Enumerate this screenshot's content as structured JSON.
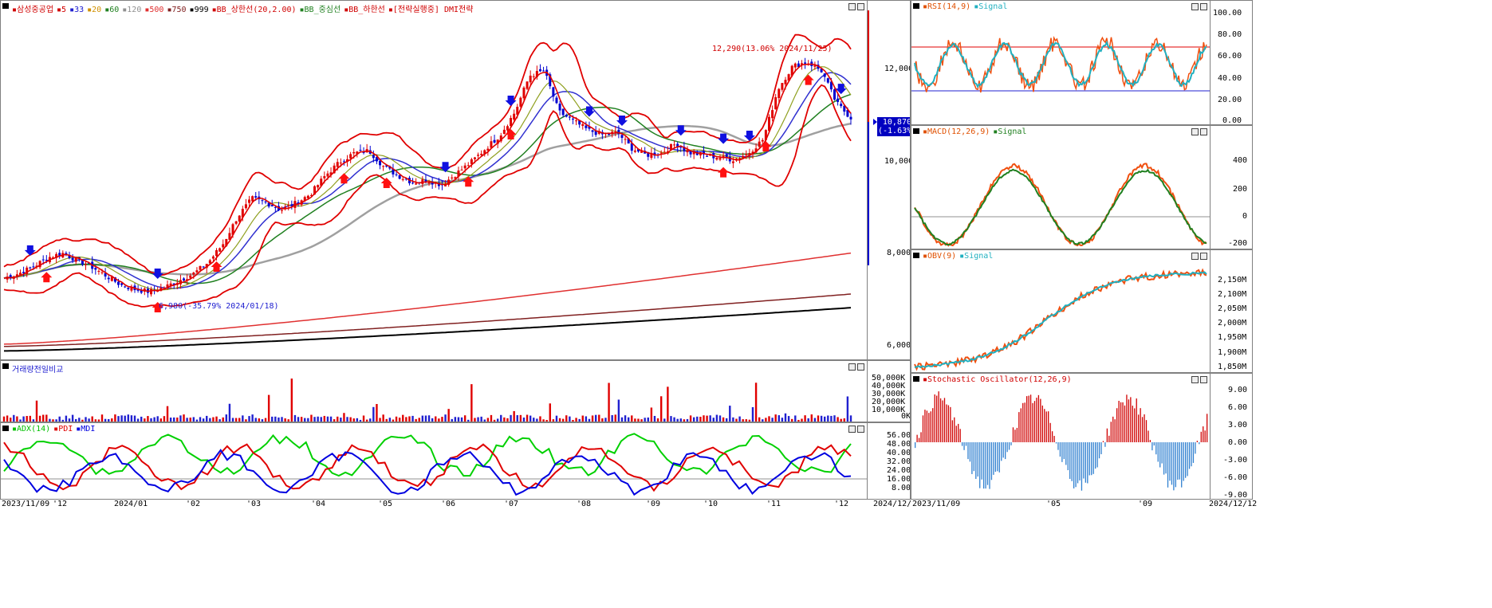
{
  "main_legend": {
    "items": [
      {
        "text": "삼성중공업",
        "color": "#d00000"
      },
      {
        "text": "5",
        "color": "#d00000"
      },
      {
        "text": "33",
        "color": "#2020d0"
      },
      {
        "text": "20",
        "color": "#d09000"
      },
      {
        "text": "60",
        "color": "#208020"
      },
      {
        "text": "120",
        "color": "#909090"
      },
      {
        "text": "500",
        "color": "#e03030"
      },
      {
        "text": "750",
        "color": "#802020"
      },
      {
        "text": "999",
        "color": "#000000"
      },
      {
        "text": "BB_상한선(20,2.00)",
        "color": "#d00000"
      },
      {
        "text": "BB_중심선",
        "color": "#208020"
      },
      {
        "text": "BB_하한선",
        "color": "#d00000"
      },
      {
        "text": "[전략실행중] DMI전략",
        "color": "#d00000"
      }
    ]
  },
  "annotations": {
    "high": "12,290(13.06% 2024/11/25)",
    "low": "6,980(-35.79% 2024/01/18)",
    "current_price": "10,870",
    "current_change": "(-1.63%)"
  },
  "volume_legend": "거래량전일비교",
  "adx_legend": [
    {
      "text": "ADX(14)",
      "color": "#00c000"
    },
    {
      "text": "PDI",
      "color": "#e00000"
    },
    {
      "text": "MDI",
      "color": "#0000e0"
    }
  ],
  "rsi_legend": [
    {
      "text": "RSI(14,9)",
      "color": "#e05000"
    },
    {
      "text": "Signal",
      "color": "#20b0c0"
    }
  ],
  "macd_legend": [
    {
      "text": "MACD(12,26,9)",
      "color": "#e05000"
    },
    {
      "text": "Signal",
      "color": "#208020"
    }
  ],
  "obv_legend": [
    {
      "text": "OBV(9)",
      "color": "#e05000"
    },
    {
      "text": "Signal",
      "color": "#20b0c0"
    }
  ],
  "stoch_legend": [
    {
      "text": "Stochastic Oscillator(12,26,9)",
      "color": "#d00000"
    }
  ],
  "price_axis": [
    "12,000",
    "10,000",
    "8,000",
    "6,000"
  ],
  "volume_axis": [
    "50,000K",
    "40,000K",
    "30,000K",
    "20,000K",
    "10,000K",
    "0K"
  ],
  "adx_axis": [
    "56.00",
    "48.00",
    "40.00",
    "32.00",
    "24.00",
    "16.00",
    "8.00"
  ],
  "rsi_axis": [
    "100.00",
    "80.00",
    "60.00",
    "40.00",
    "20.00",
    "0.00"
  ],
  "macd_axis": [
    "400",
    "200",
    "0",
    "-200"
  ],
  "obv_axis": [
    "2,150M",
    "2,100M",
    "2,050M",
    "2,000M",
    "1,950M",
    "1,900M",
    "1,850M"
  ],
  "stoch_axis": [
    "9.00",
    "6.00",
    "3.00",
    "0.00",
    "-3.00",
    "-6.00",
    "-9.00"
  ],
  "date_axis_main": [
    "2023/11/09",
    "'12",
    "2024/01",
    "'02",
    "'03",
    "'04",
    "'05",
    "'06",
    "'07",
    "'08",
    "'09",
    "'10",
    "'11",
    "'12",
    "2024/12/12"
  ],
  "date_axis_right": [
    "2023/11/09",
    "'05",
    "'09",
    "2024/12/12"
  ],
  "chart_data": [
    {
      "type": "line",
      "title": "삼성중공업",
      "ylim": [
        5600,
        13300
      ],
      "series": [
        {
          "name": "삼성중공업",
          "values": [
            7350,
            7450,
            7600,
            7800,
            7900,
            7750,
            7600,
            7400,
            7200,
            7100,
            7050,
            7150,
            7300,
            7450,
            7700,
            8100,
            8700,
            9100,
            9000,
            8850,
            9000,
            9200,
            9600,
            9900,
            10100,
            10150,
            9800,
            9600,
            9450,
            9500,
            9400,
            9650,
            9900,
            10200,
            10500,
            11000,
            11800,
            11900,
            11000,
            10800,
            10600,
            10500,
            10550,
            10200,
            10050,
            10100,
            10300,
            10100,
            10050,
            10000,
            9950,
            10100,
            10400,
            11500,
            12000,
            12100,
            11900,
            11200,
            10870
          ]
        }
      ]
    },
    {
      "type": "bar",
      "title": "거래량전일비교",
      "ylim": [
        0,
        50000
      ]
    },
    {
      "type": "line",
      "title": "ADX(14) PDI MDI",
      "ylim": [
        0,
        60
      ]
    },
    {
      "type": "line",
      "title": "RSI(14,9)",
      "ylim": [
        0,
        100
      ]
    },
    {
      "type": "line",
      "title": "MACD(12,26,9)",
      "ylim": [
        -300,
        600
      ]
    },
    {
      "type": "line",
      "title": "OBV(9)",
      "ylim": [
        1820,
        2200
      ]
    },
    {
      "type": "bar",
      "title": "Stochastic Oscillator(12,26,9)",
      "ylim": [
        -10,
        11
      ]
    }
  ]
}
